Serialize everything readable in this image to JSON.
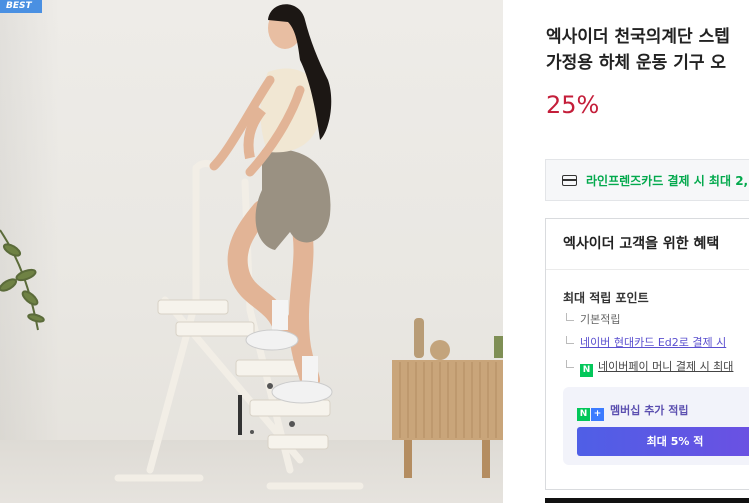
{
  "badge": {
    "label": "BEST"
  },
  "product": {
    "title_line1": "엑사이더 천국의계단 스텝",
    "title_line2": "가정용 하체 운동 기구 오",
    "discount": "25%"
  },
  "card_promo": {
    "text": "라인프렌즈카드 결제 시 최대 2,"
  },
  "benefits": {
    "title": "엑사이더 고객을 위한 혜택",
    "points_title": "최대 적립 포인트",
    "items": [
      {
        "label": "기본적립"
      },
      {
        "label": "네이버 현대카드 Ed2로 결제 시"
      },
      {
        "badge": "N",
        "label": "네이버페이 머니 결제 시 최대"
      }
    ],
    "membership": {
      "badge_n": "N",
      "badge_plus": "+",
      "label": "멤버십 추가 적립",
      "button": "최대 5% 적"
    }
  },
  "colors": {
    "discount": "#c41e3a",
    "card_promo": "#03a94d",
    "naver_green": "#03c75a",
    "membership_button": "#5b56e4"
  }
}
